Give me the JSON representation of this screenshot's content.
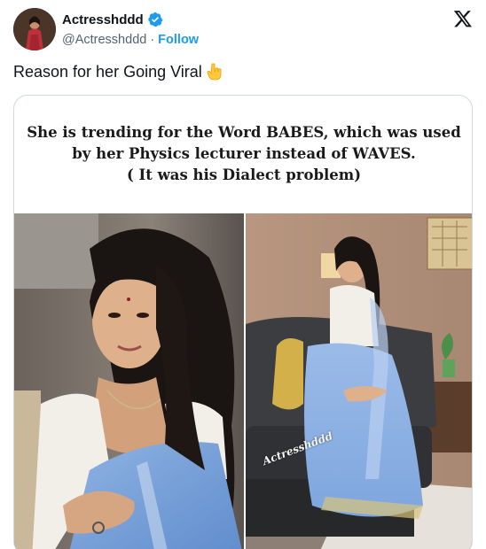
{
  "header": {
    "display_name": "Actresshddd",
    "handle": "@Actresshddd",
    "separator": "·",
    "follow_label": "Follow",
    "verified_color": "#1d9bf0",
    "logo_icon": "x-logo-icon"
  },
  "tweet": {
    "text": "Reason for her Going Viral",
    "emoji_icon": "pointing-down-hand-emoji"
  },
  "media": {
    "caption_lines": [
      "She is trending for the Word BABES, which was used",
      "by her Physics lecturer instead of WAVES.",
      "( It was his Dialect problem)"
    ],
    "watermark": "Actresshddd",
    "photos": [
      "woman-in-blue-saree-closeup",
      "woman-in-blue-saree-seated-on-sofa"
    ]
  }
}
